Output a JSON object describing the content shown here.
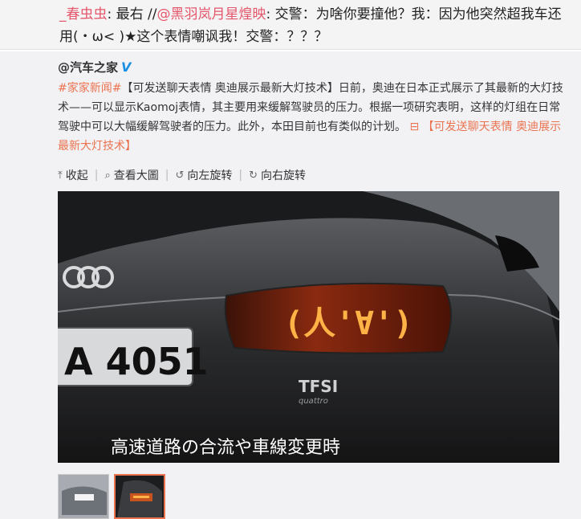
{
  "comment": {
    "user1": "_春虫虫",
    "text1": ": 最右 //",
    "user2": "@黑羽岚月星煌映",
    "text2": ": 交警：为啥你要撞他？我：因为他突然超我车还用(・ω< )★这个表情嘲讽我！交警：？？？"
  },
  "original": {
    "author": "@汽车之家",
    "verified_icon": "V",
    "hashtag": "#家家新闻#",
    "body": "【可发送聊天表情 奥迪展示最新大灯技术】日前，奥迪在日本正式展示了其最新的大灯技术——可以显示Kaomoj表情，其主要用来缓解驾驶员的压力。根据一项研究表明，这样的灯组在日常驾驶中可以大幅缓解驾驶者的压力。此外，本田目前也有类似的计划。",
    "link_icon": "⊟",
    "link_text": "【可发送聊天表情 奥迪展示最新大灯技术】"
  },
  "toolbar": {
    "collapse": "收起",
    "view_large": "查看大圖",
    "rotate_left": "向左旋转",
    "rotate_right": "向右旋转",
    "collapse_icon": "⤒",
    "view_icon": "⌕",
    "rotate_left_icon": "↺",
    "rotate_right_icon": "↻"
  },
  "photo": {
    "plate": "A 4051",
    "badge": "TFSI",
    "badge_sub": "quattro",
    "emoticon": "(人'∀')",
    "caption": "高速道路の合流や車線変更時"
  },
  "colors": {
    "username": "#e5566b",
    "link": "#eb7350",
    "verified": "#1a8fe3",
    "led": "#ffb347"
  }
}
